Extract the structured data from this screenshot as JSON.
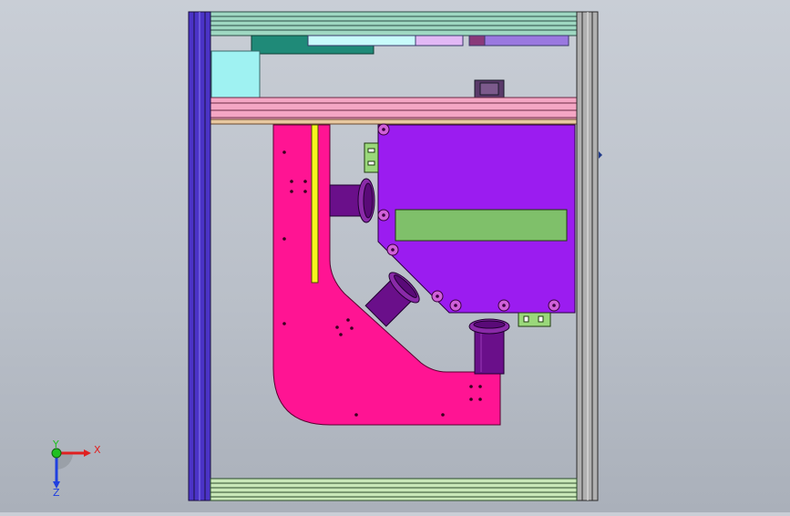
{
  "viewport": {
    "background_top": "#c9ced6",
    "background_bottom": "#aab0ba"
  },
  "triad": {
    "x_label": "X",
    "y_label": "Y",
    "z_label": "Z",
    "x_color": "#e02020",
    "y_color": "#20c020",
    "z_color": "#2040e0"
  },
  "colors": {
    "frame_left": "#4b33c7",
    "frame_right": "#a8a8a8",
    "rail_top": "#9fd8c2",
    "rail_pink": "#f4a6c4",
    "plate_magenta": "#ff1493",
    "housing_violet": "#9b1cf0",
    "window_green": "#7fc06a",
    "pipe_purple": "#6a0f8a",
    "strip_yellow": "#f5f51e",
    "block_cyan": "#9ff2f2",
    "block_teal": "#1f8a78"
  }
}
